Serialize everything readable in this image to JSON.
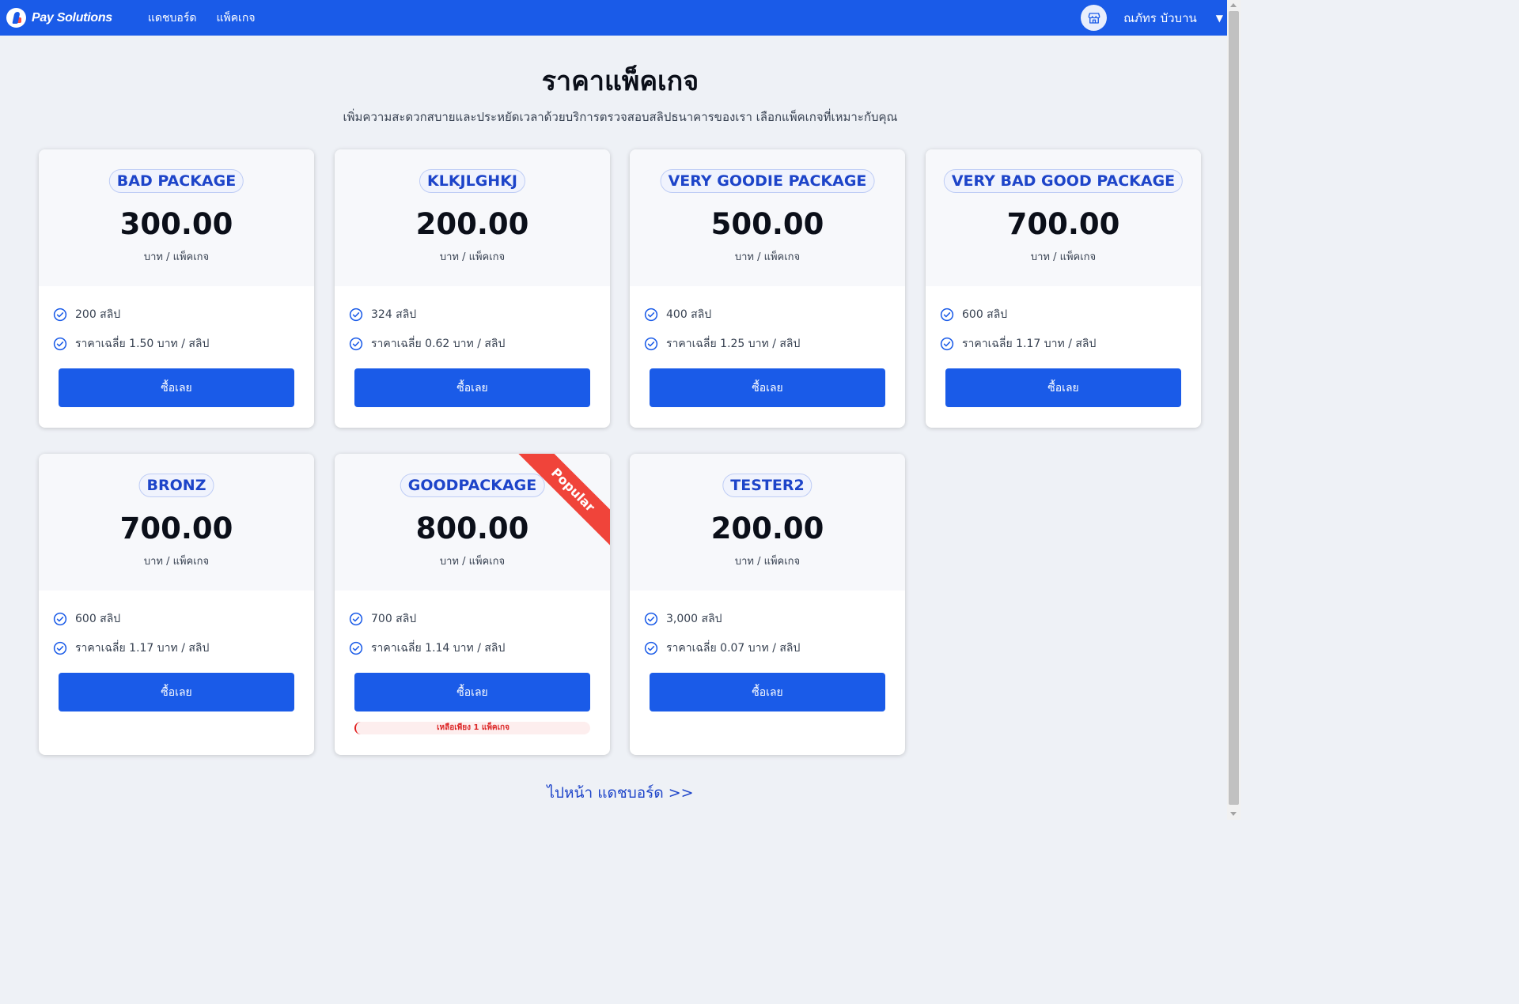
{
  "header": {
    "brand": "Pay Solutions",
    "nav": [
      "แดชบอร์ด",
      "แพ็คเกจ"
    ],
    "user_name": "ณภัทร บัวบาน",
    "avatar_icon": "store-icon",
    "caret_icon": "caret-down-icon"
  },
  "hero": {
    "title": "ราคาแพ็คเกจ",
    "subtitle": "เพิ่มความสะดวกสบายและประหยัดเวลาด้วยบริการตรวจสอบสลิปธนาคารของเรา เลือกแพ็คเกจที่เหมาะกับคุณ"
  },
  "packages": [
    {
      "name": "BAD PACKAGE",
      "price": "300.00",
      "unit": "บาท / แพ็คเกจ",
      "slips": "200 สลิป",
      "avg": "ราคาเฉลี่ย 1.50 บาท / สลิป",
      "buy": "ซื้อเลย"
    },
    {
      "name": "KLKJLGHKJ",
      "price": "200.00",
      "unit": "บาท / แพ็คเกจ",
      "slips": "324 สลิป",
      "avg": "ราคาเฉลี่ย 0.62 บาท / สลิป",
      "buy": "ซื้อเลย"
    },
    {
      "name": "VERY GOODIE PACKAGE",
      "price": "500.00",
      "unit": "บาท / แพ็คเกจ",
      "slips": "400 สลิป",
      "avg": "ราคาเฉลี่ย 1.25 บาท / สลิป",
      "buy": "ซื้อเลย"
    },
    {
      "name": "VERY BAD GOOD PACKAGE",
      "price": "700.00",
      "unit": "บาท / แพ็คเกจ",
      "slips": "600 สลิป",
      "avg": "ราคาเฉลี่ย 1.17 บาท / สลิป",
      "buy": "ซื้อเลย"
    },
    {
      "name": "BRONZ",
      "price": "700.00",
      "unit": "บาท / แพ็คเกจ",
      "slips": "600 สลิป",
      "avg": "ราคาเฉลี่ย 1.17 บาท / สลิป",
      "buy": "ซื้อเลย"
    },
    {
      "name": "GOODPACKAGE",
      "price": "800.00",
      "unit": "บาท / แพ็คเกจ",
      "slips": "700 สลิป",
      "avg": "ราคาเฉลี่ย 1.14 บาท / สลิป",
      "buy": "ซื้อเลย",
      "ribbon": "Popular",
      "stock_note": "เหลือเพียง 1 แพ็คเกจ"
    },
    {
      "name": "TESTER2",
      "price": "200.00",
      "unit": "บาท / แพ็คเกจ",
      "slips": "3,000 สลิป",
      "avg": "ราคาเฉลี่ย 0.07 บาท / สลิป",
      "buy": "ซื้อเลย"
    }
  ],
  "footer_link": "ไปหน้า แดชบอร์ด >>",
  "colors": {
    "primary": "#1a5be8",
    "badge_text": "#1d44c9",
    "ribbon": "#f0443a",
    "background": "#eef1f6"
  }
}
